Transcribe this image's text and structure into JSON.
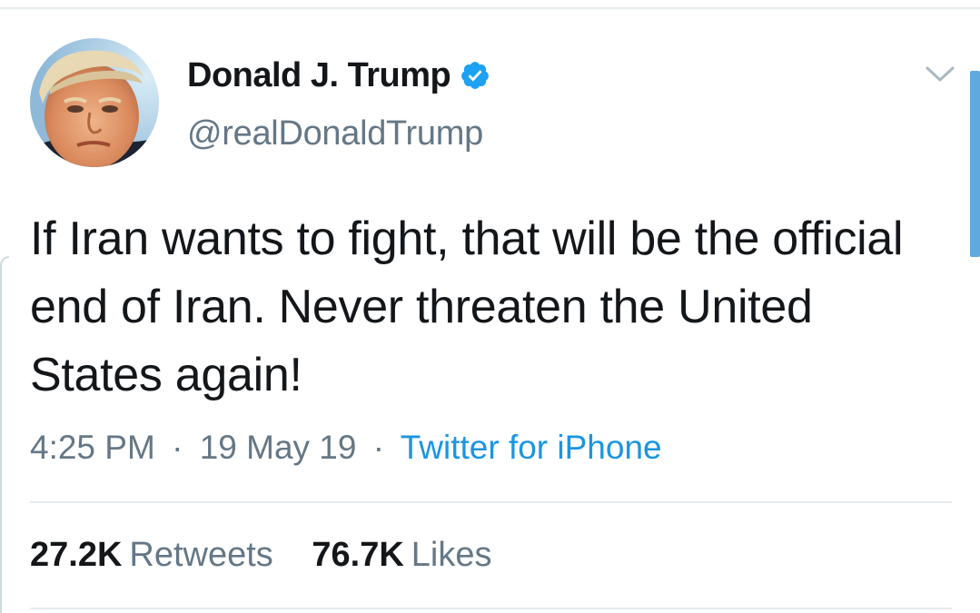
{
  "user": {
    "name": "Donald J. Trump",
    "handle": "@realDonaldTrump",
    "verified": true
  },
  "tweet": {
    "text": "If Iran wants to fight, that will be the official end of Iran. Never threaten the United States again!",
    "time": "4:25 PM",
    "separator": "·",
    "date": "19 May 19",
    "source": "Twitter for iPhone"
  },
  "stats": {
    "retweets_count": "27.2K",
    "retweets_label": "Retweets",
    "likes_count": "76.7K",
    "likes_label": "Likes"
  },
  "colors": {
    "text_primary": "#14171a",
    "text_secondary": "#657786",
    "link": "#1b95e0",
    "verified_badge": "#1da1f2",
    "divider": "#e6ecf0"
  },
  "icons": {
    "verified": "verified-badge-icon",
    "menu": "chevron-down-icon"
  }
}
